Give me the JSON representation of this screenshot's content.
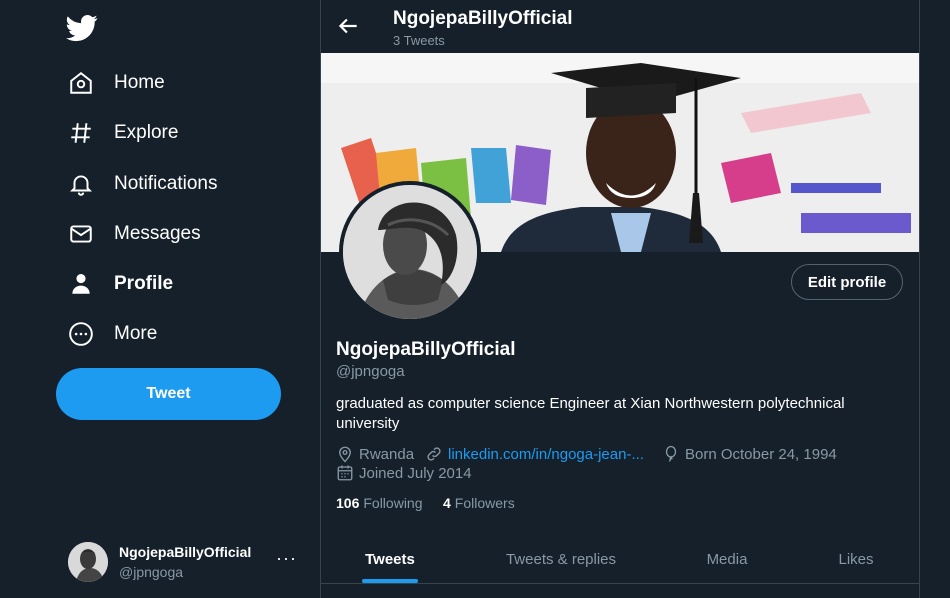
{
  "nav": {
    "items": [
      {
        "label": "Home",
        "icon": "home-icon"
      },
      {
        "label": "Explore",
        "icon": "hashtag-icon"
      },
      {
        "label": "Notifications",
        "icon": "bell-icon"
      },
      {
        "label": "Messages",
        "icon": "envelope-icon"
      },
      {
        "label": "Profile",
        "icon": "person-icon",
        "active": true
      },
      {
        "label": "More",
        "icon": "more-circle-icon"
      }
    ],
    "tweet_button": "Tweet"
  },
  "account": {
    "name": "NgojepaBillyOfficial",
    "handle": "@jpngoga",
    "more": "···"
  },
  "header": {
    "title": "NgojepaBillyOfficial",
    "tweet_count": "3 Tweets"
  },
  "profile": {
    "edit_label": "Edit profile",
    "name": "NgojepaBillyOfficial",
    "handle": "@jpngoga",
    "bio": "graduated as computer science Engineer at Xian Northwestern polytechnical university",
    "location": "Rwanda",
    "website": "linkedin.com/in/ngoga-jean-...",
    "born": "Born October 24, 1994",
    "joined": "Joined July 2014",
    "following_count": "106",
    "following_label": "Following",
    "followers_count": "4",
    "followers_label": "Followers"
  },
  "tabs": [
    {
      "label": "Tweets",
      "active": true
    },
    {
      "label": "Tweets & replies"
    },
    {
      "label": "Media"
    },
    {
      "label": "Likes"
    }
  ],
  "colors": {
    "background": "#15202b",
    "accent": "#1d9bf0",
    "secondary_text": "#8899a6",
    "border": "#38444d"
  }
}
